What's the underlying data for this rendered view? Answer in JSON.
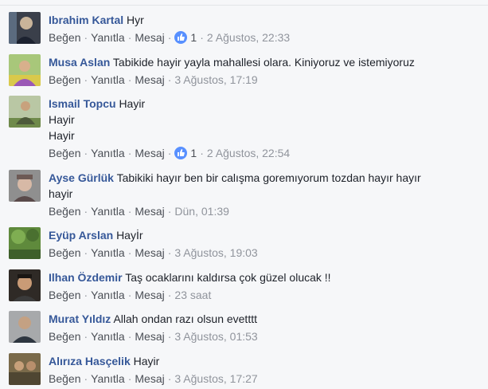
{
  "actions": {
    "like": "Beğen",
    "reply": "Yanıtla",
    "message": "Mesaj",
    "sep": "·"
  },
  "colors": {
    "author": "#365899",
    "meta": "#90949c",
    "like_badge": "#5890ff"
  },
  "comments": [
    {
      "author": "Ibrahim Kartal",
      "lines": [
        "Hyr"
      ],
      "likes": "1",
      "time": "2 Ağustos, 22:33"
    },
    {
      "author": "Musa Aslan",
      "lines": [
        "Tabikide hayir yayla mahallesi olara. Kiniyoruz ve istemiyoruz"
      ],
      "likes": "",
      "time": "3 Ağustos, 17:19"
    },
    {
      "author": "Ismail Topcu",
      "lines": [
        "Hayir",
        "Hayir",
        "Hayir"
      ],
      "likes": "1",
      "time": "2 Ağustos, 22:54"
    },
    {
      "author": "Ayse Gürlük",
      "lines": [
        "Tabikiki hayır ben bir calışma goremıyorum tozdan hayır hayır",
        "hayir"
      ],
      "likes": "",
      "time": "Dün, 01:39"
    },
    {
      "author": "Eyüp Arslan",
      "lines": [
        "Hayİr"
      ],
      "likes": "",
      "time": "3 Ağustos, 19:03"
    },
    {
      "author": "Ilhan Özdemir",
      "lines": [
        "Taş ocaklarını kaldırsa çok güzel olucak !!"
      ],
      "likes": "",
      "time": "23 saat"
    },
    {
      "author": "Murat Yıldız",
      "lines": [
        "Allah ondan razı olsun evetttt"
      ],
      "likes": "",
      "time": "3 Ağustos, 01:53"
    },
    {
      "author": "Alırıza Hasçelik",
      "lines": [
        "Hayir"
      ],
      "likes": "",
      "time": "3 Ağustos, 17:27"
    }
  ]
}
